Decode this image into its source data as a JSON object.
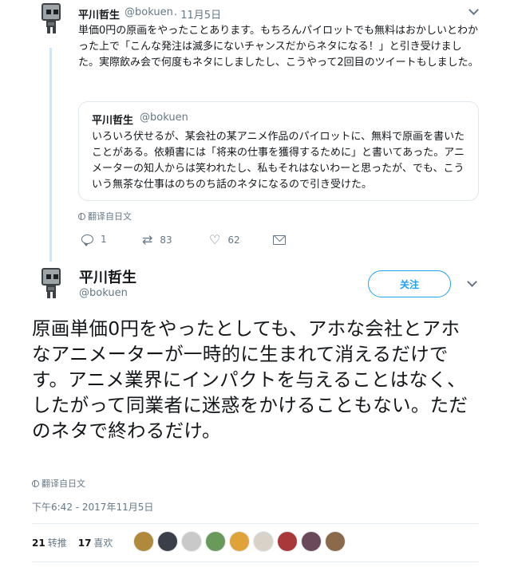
{
  "parent_tweet": {
    "name": "平川哲生",
    "handle": "@bokuen",
    "date": "· 11月5日",
    "text": "単価0円の原画をやったことあります。もちろんパイロットでも無料はおかしいとわかった上で「こんな発注は滅多にないチャンスだからネタになる！」と引き受けました。実際飲み会で何度もネタにしましたし、こうやって2回目のツイートもしました。",
    "quote": {
      "name": "平川哲生",
      "handle": "@bokuen",
      "text": "いろいろ伏せるが、某会社の某アニメ作品のパイロットに、無料で原画を書いたことがある。依頼書には「将来の仕事を獲得するために」と書いてあった。アニメーターの知人からは笑われたし、私もそれはないわーと思ったが、でも、こういう無茶な仕事はのちのち話のネタになるので引き受けた。"
    },
    "translate_label": "翻译自日文",
    "actions": {
      "replies": "1",
      "retweets": "83",
      "likes": "62"
    }
  },
  "main_tweet": {
    "name": "平川哲生",
    "handle": "@bokuen",
    "follow_label": "关注",
    "text": "原画単価0円をやったとしても、アホな会社とアホなアニメーターが一時的に生まれて消えるだけです。アニメ業界にインパクトを与えることはなく、したがって同業者に迷惑をかけることもない。ただのネタで終わるだけ。",
    "translate_label": "翻译自日文",
    "timestamp": "下午6:42 - 2017年11月5日",
    "stats": {
      "retweets_count": "21",
      "retweets_label": "转推",
      "likes_count": "17",
      "likes_label": "喜欢"
    }
  },
  "icons": {
    "avatar": "robot-avatar-icon",
    "chevron": "chevron-down-icon",
    "globe": "globe-icon",
    "reply": "reply-icon",
    "retweet": "retweet-icon",
    "like": "heart-icon",
    "dm": "envelope-icon"
  },
  "colors": {
    "accent": "#1da1f2",
    "secondary_text": "#657786",
    "thread_line": "#d1e4f1",
    "border": "#e1e8ed"
  },
  "liker_avatar_colors": [
    "#b08a3a",
    "#3a3f4a",
    "#c9c9c9",
    "#6a9a5a",
    "#e0a33a",
    "#d8d2c8",
    "#a8383a",
    "#6a4a5a",
    "#8a6a4a"
  ]
}
